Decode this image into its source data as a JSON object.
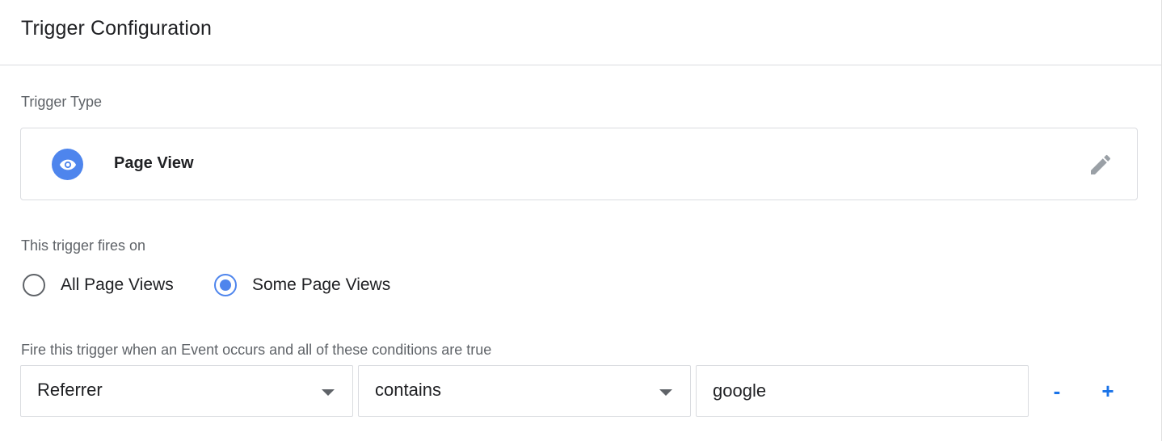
{
  "header": {
    "title": "Trigger Configuration"
  },
  "trigger_type": {
    "label": "Trigger Type",
    "name": "Page View",
    "icon": "eye-icon",
    "edit_icon": "pencil-icon",
    "accent": "#4e85ed"
  },
  "fires_on": {
    "label": "This trigger fires on",
    "options": [
      {
        "label": "All Page Views",
        "selected": false
      },
      {
        "label": "Some Page Views",
        "selected": true
      }
    ]
  },
  "conditions": {
    "label": "Fire this trigger when an Event occurs and all of these conditions are true",
    "rows": [
      {
        "variable": "Referrer",
        "operator": "contains",
        "value": "google"
      }
    ],
    "remove_label": "-",
    "add_label": "+"
  }
}
